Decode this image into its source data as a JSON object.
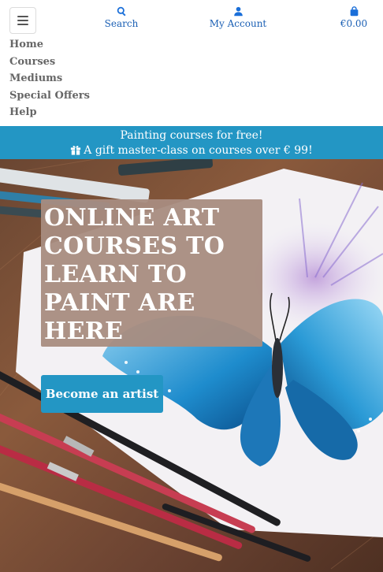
{
  "header": {
    "menu_icon": "hamburger-icon",
    "nav": [
      {
        "label": "Search",
        "icon": "search-icon"
      },
      {
        "label": "My Account",
        "icon": "user-icon"
      },
      {
        "label": "€0.00",
        "icon": "shopping-bag-icon"
      }
    ]
  },
  "menu": {
    "items": [
      "Home",
      "Courses",
      "Mediums",
      "Special Offers",
      "Help"
    ]
  },
  "promo": {
    "line1": "Painting courses for free!",
    "line2": "A gift master-class on courses over € 99!",
    "icon": "gift-icon",
    "color": "#2396c4"
  },
  "hero": {
    "title": "ONLINE ART COURSES TO LEARN TO PAINT ARE HERE",
    "button_label": "Become an artist",
    "button_color": "#2396c4"
  }
}
